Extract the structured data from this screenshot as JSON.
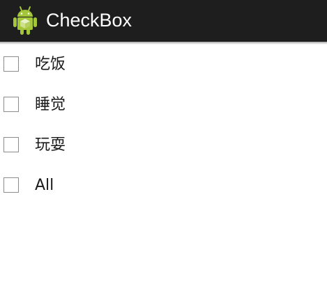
{
  "action_bar": {
    "title": "CheckBox",
    "icon": "android-robot-icon",
    "background": "#1e1e1e",
    "icon_color": "#a4c639"
  },
  "checkboxes": [
    {
      "label": "吃饭",
      "checked": false
    },
    {
      "label": "睡觉",
      "checked": false
    },
    {
      "label": "玩耍",
      "checked": false
    },
    {
      "label": "All",
      "checked": false
    }
  ]
}
